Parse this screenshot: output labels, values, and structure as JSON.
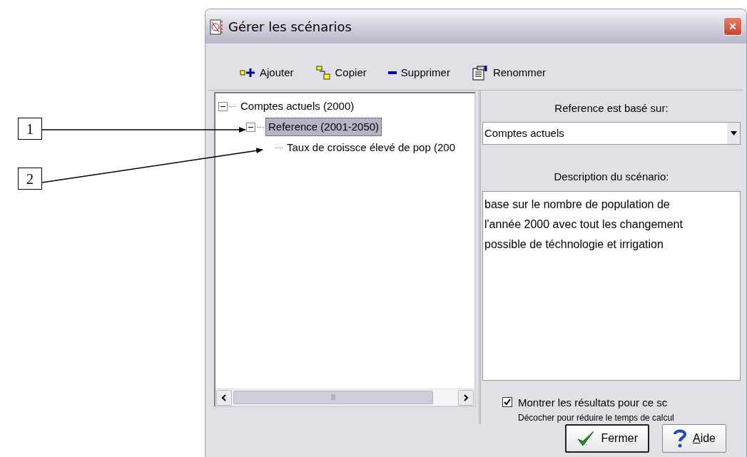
{
  "window": {
    "title": "Gérer les scénarios"
  },
  "toolbar": [
    {
      "label": "Ajouter",
      "kind": "add"
    },
    {
      "label": "Copier",
      "kind": "copy"
    },
    {
      "label": "Supprimer",
      "kind": "delete"
    },
    {
      "label": "Renommer",
      "kind": "rename"
    }
  ],
  "tree": [
    {
      "label": "Comptes actuels (2000)",
      "expanded": true,
      "selected": false,
      "children": [
        {
          "label": "Reference (2001-2050)",
          "expanded": true,
          "selected": true,
          "children": [
            {
              "label": "Taux de croissce élevé de pop (200",
              "selected": false
            }
          ]
        }
      ]
    }
  ],
  "base_label": "Reference est basé sur:",
  "base_select": {
    "value": "Comptes actuels"
  },
  "description_label": "Description du scénario:",
  "description": {
    "value": "base sur le nombre de population de\nl'année 2000 avec tout les changement\npossible de téchnologie et irrigation"
  },
  "show_results": {
    "label": "Montrer les résultats pour ce sc",
    "checked": true,
    "hint": "Décocher pour réduire le temps de calcul"
  },
  "buttons": [
    {
      "label": "Fermer",
      "kind": "close"
    },
    {
      "label": "Aide",
      "kind": "help"
    }
  ],
  "callouts": [
    {
      "label": "1"
    },
    {
      "label": "2"
    }
  ]
}
